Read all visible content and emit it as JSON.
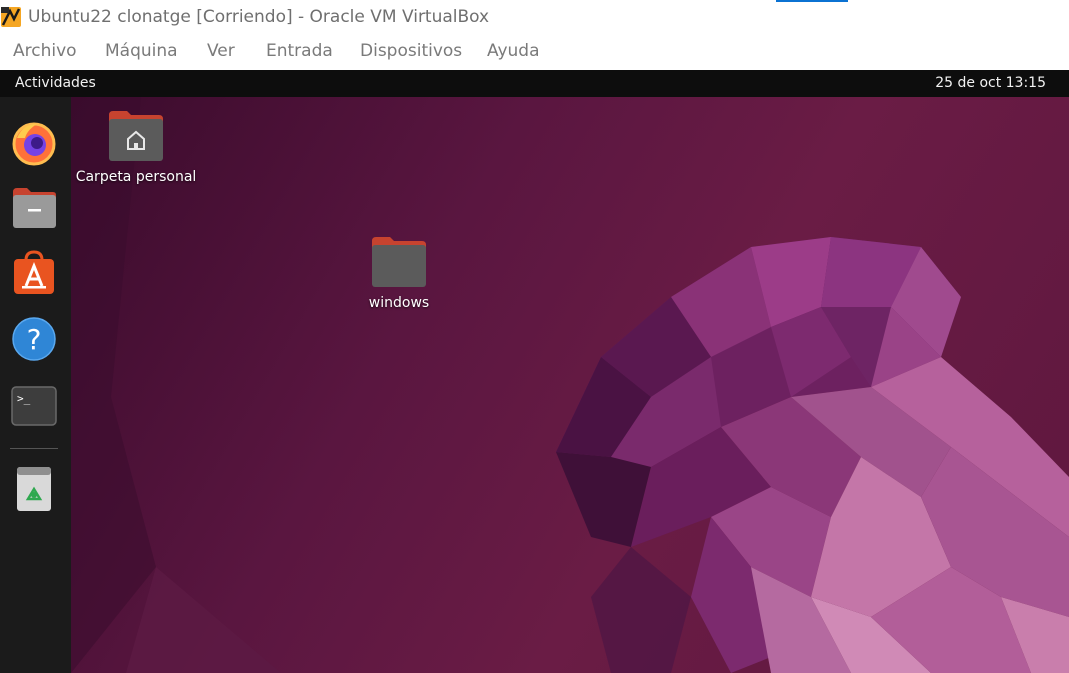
{
  "window": {
    "title": "Ubuntu22 clonatge [Corriendo] - Oracle VM VirtualBox",
    "logo_icon": "virtualbox-icon"
  },
  "menubar": {
    "items": [
      {
        "label": "Archivo"
      },
      {
        "label": "Máquina"
      },
      {
        "label": "Ver"
      },
      {
        "label": "Entrada"
      },
      {
        "label": "Dispositivos"
      },
      {
        "label": "Ayuda"
      }
    ]
  },
  "guest": {
    "topbar": {
      "activities_label": "Actividades",
      "clock": "25 de oct  13:15"
    },
    "dock": {
      "items": [
        {
          "name": "firefox",
          "icon": "firefox-icon"
        },
        {
          "name": "files",
          "icon": "files-icon"
        },
        {
          "name": "software",
          "icon": "software-center-icon"
        },
        {
          "name": "help",
          "icon": "help-icon"
        },
        {
          "name": "terminal",
          "icon": "terminal-icon"
        },
        {
          "name": "trash",
          "icon": "trash-icon"
        }
      ],
      "terminal_prompt": ">_"
    },
    "desktop": {
      "icons": [
        {
          "label": "Carpeta personal",
          "icon": "home-folder-icon"
        },
        {
          "label": "windows",
          "icon": "folder-icon"
        }
      ]
    },
    "colors": {
      "wallpaper": "#5a1640",
      "accent": "#e95420",
      "topbar": "#0d0d0d",
      "dock": "#1b1b1b"
    }
  }
}
